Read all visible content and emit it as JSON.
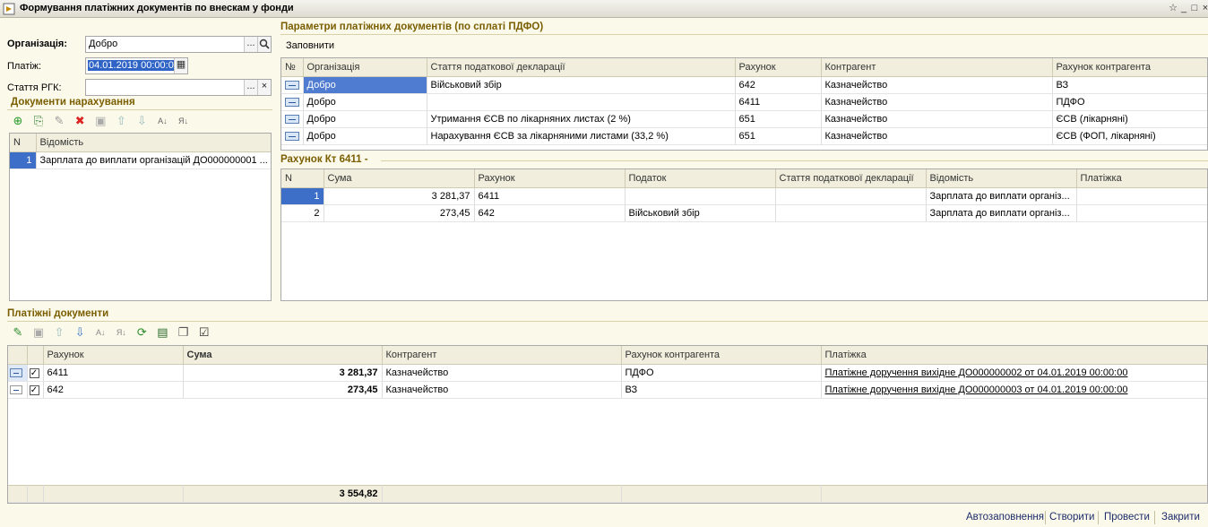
{
  "window": {
    "title": "Формування платіжних документів по внескам у фонди",
    "controls": [
      "_",
      "□",
      "×"
    ]
  },
  "form": {
    "org_label": "Організація:",
    "org_value": "Добро",
    "platizh_label": "Платіж:",
    "platizh_value": "04.01.2019 00:00:0",
    "stattya_label": "Стаття РГК:",
    "stattya_value": "",
    "dots": "...",
    "clear": "×"
  },
  "docs_nar": {
    "title": "Документи нарахування",
    "headers": [
      "N",
      "Відомість"
    ],
    "rows": [
      {
        "n": "1",
        "name": "Зарплата до виплати організацій ДО000000001 ..."
      }
    ]
  },
  "params": {
    "title": "Параметри платіжних документів (по сплаті ПДФО)",
    "fill_button": "Заповнити",
    "headers": [
      "№",
      "Організація",
      "Стаття податкової декларації",
      "Рахунок",
      "Контрагент",
      "Рахунок контрагента"
    ],
    "rows": [
      {
        "org": "Добро",
        "article": "Військовий збір",
        "account": "642",
        "counterparty": "Казначейство",
        "cp_account": "ВЗ"
      },
      {
        "org": "Добро",
        "article": "",
        "account": "6411",
        "counterparty": "Казначейство",
        "cp_account": "ПДФО"
      },
      {
        "org": "Добро",
        "article": "Утримання ЄСВ по лікарняних листах (2 %)",
        "account": "651",
        "counterparty": "Казначейство",
        "cp_account": "ЄСВ (лікарняні)"
      },
      {
        "org": "Добро",
        "article": "Нарахування ЄСВ за лікарняними листами (33,2 %)",
        "account": "651",
        "counterparty": "Казначейство",
        "cp_account": "ЄСВ (ФОП, лікарняні)"
      }
    ]
  },
  "rakhunok": {
    "title": "Рахунок Кт 6411 -",
    "headers": [
      "N",
      "Сума",
      "Рахунок",
      "Податок",
      "Стаття податкової декларації",
      "Відомість",
      "Платіжка"
    ],
    "rows": [
      {
        "n": "1",
        "sum": "3 281,37",
        "account": "6411",
        "tax": "",
        "article": "",
        "vidomist": "Зарплата до виплати організ...",
        "platizhka": ""
      },
      {
        "n": "2",
        "sum": "273,45",
        "account": "642",
        "tax": "Військовий збір",
        "article": "",
        "vidomist": "Зарплата до виплати організ...",
        "platizhka": ""
      }
    ]
  },
  "payments": {
    "title": "Платіжні документи",
    "headers": [
      "Рахунок",
      "Сума",
      "Контрагент",
      "Рахунок контрагента",
      "Платіжка"
    ],
    "rows": [
      {
        "account": "6411",
        "sum": "3 281,37",
        "counterparty": "Казначейство",
        "cp_account": "ПДФО",
        "doc": "Платіжне доручення вихідне ДО000000002 от 04.01.2019 00:00:00"
      },
      {
        "account": "642",
        "sum": "273,45",
        "counterparty": "Казначейство",
        "cp_account": "ВЗ",
        "doc": "Платіжне доручення вихідне ДО000000003 от 04.01.2019 00:00:00"
      }
    ],
    "total": "3 554,82"
  },
  "bottom": {
    "autofill": "Автозаповнення",
    "create": "Створити",
    "post": "Провести",
    "close": "Закрити"
  },
  "colors": {
    "section_title": "#7a5e00",
    "selection": "#3d6fc8",
    "background": "#fbf9ea"
  }
}
